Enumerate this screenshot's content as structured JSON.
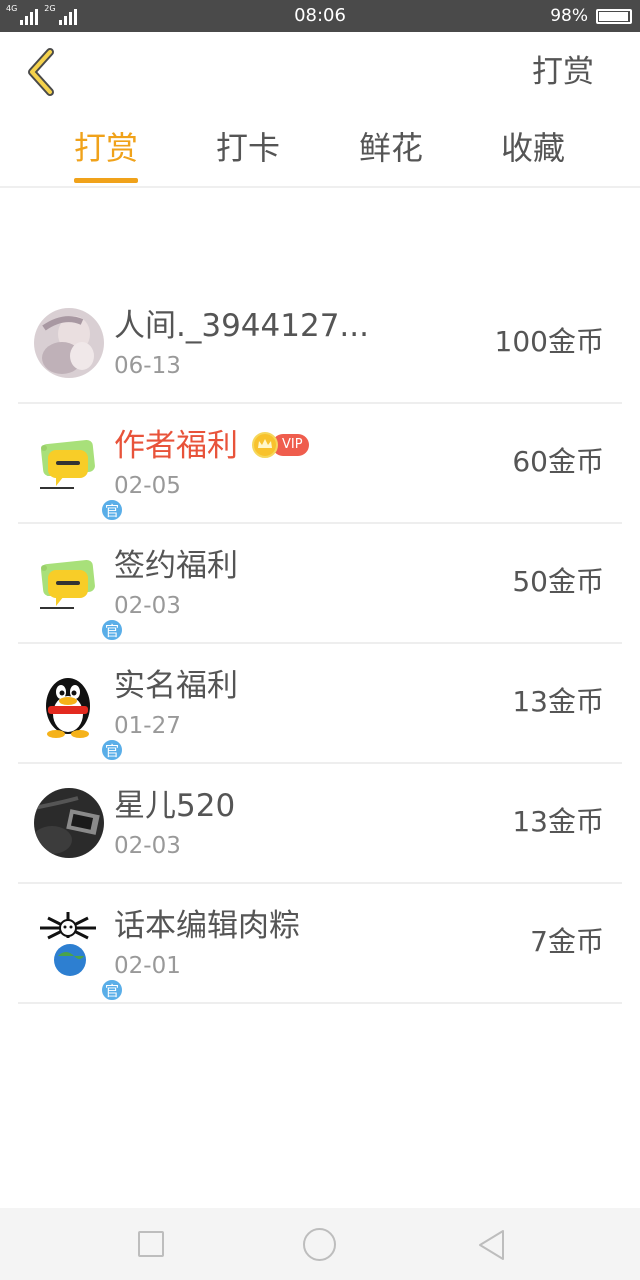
{
  "status_bar": {
    "signal_1": "4G",
    "signal_2": "2G",
    "time": "08:06",
    "battery_percent": "98%",
    "battery_level": 0.98
  },
  "header": {
    "back_icon": "chevron-left-icon",
    "action_label": "打赏"
  },
  "tabs": [
    {
      "label": "打赏",
      "active": true
    },
    {
      "label": "打卡",
      "active": false
    },
    {
      "label": "鲜花",
      "active": false
    },
    {
      "label": "收藏",
      "active": false
    }
  ],
  "colors": {
    "accent": "#f0a21a",
    "highlight_name": "#e8533a",
    "official_badge": "#5aaee8",
    "vip": "#ef5d4d"
  },
  "rewards": [
    {
      "name": "人间._3944127...",
      "date": "06-13",
      "amount": "100金币",
      "avatar": "photo-avatar",
      "official": false,
      "vip": false
    },
    {
      "name": "作者福利",
      "date": "02-05",
      "amount": "60金币",
      "avatar": "chat-bubble-avatar",
      "official": true,
      "official_label": "官",
      "vip": true,
      "vip_label": "VIP"
    },
    {
      "name": "签约福利",
      "date": "02-03",
      "amount": "50金币",
      "avatar": "chat-bubble-avatar",
      "official": true,
      "official_label": "官",
      "vip": false
    },
    {
      "name": "实名福利",
      "date": "01-27",
      "amount": "13金币",
      "avatar": "penguin-avatar",
      "official": true,
      "official_label": "官",
      "vip": false
    },
    {
      "name": "星儿520",
      "date": "02-03",
      "amount": "13金币",
      "avatar": "dark-photo-avatar",
      "official": false,
      "vip": false
    },
    {
      "name": "话本编辑肉粽",
      "date": "02-01",
      "amount": "7金币",
      "avatar": "globe-avatar",
      "official": true,
      "official_label": "官",
      "vip": false
    }
  ],
  "nav_bar": {
    "recents_icon": "square-icon",
    "home_icon": "circle-icon",
    "back_icon": "triangle-back-icon"
  }
}
